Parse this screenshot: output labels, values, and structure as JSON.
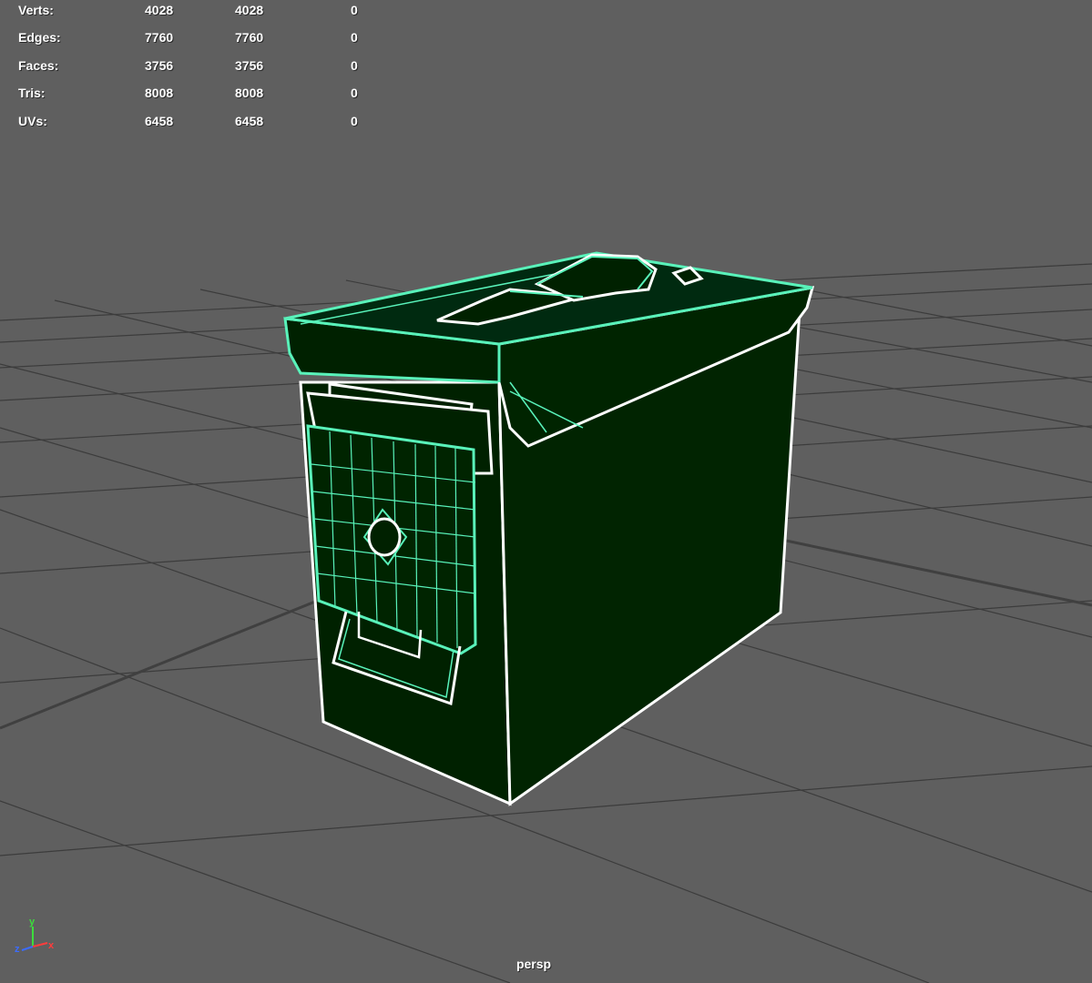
{
  "viewport": {
    "background_color": "#5f5f5f",
    "grid_color": "#3c3c3c",
    "mesh_fill_color": "#002100",
    "wire_white_color": "#ffffff",
    "wire_select_color": "#59f2ba",
    "camera_name": "persp"
  },
  "hud": {
    "rows": [
      {
        "label": "Verts:",
        "a": "4028",
        "b": "4028",
        "c": "0"
      },
      {
        "label": "Edges:",
        "a": "7760",
        "b": "7760",
        "c": "0"
      },
      {
        "label": "Faces:",
        "a": "3756",
        "b": "3756",
        "c": "0"
      },
      {
        "label": "Tris:",
        "a": "8008",
        "b": "8008",
        "c": "0"
      },
      {
        "label": "UVs:",
        "a": "6458",
        "b": "6458",
        "c": "0"
      }
    ]
  },
  "axis": {
    "y_label": "y",
    "z_label": "z",
    "x_label": "x",
    "y_color": "#3cdc3c",
    "z_color": "#3c6cff",
    "x_color": "#ff3c3c"
  }
}
